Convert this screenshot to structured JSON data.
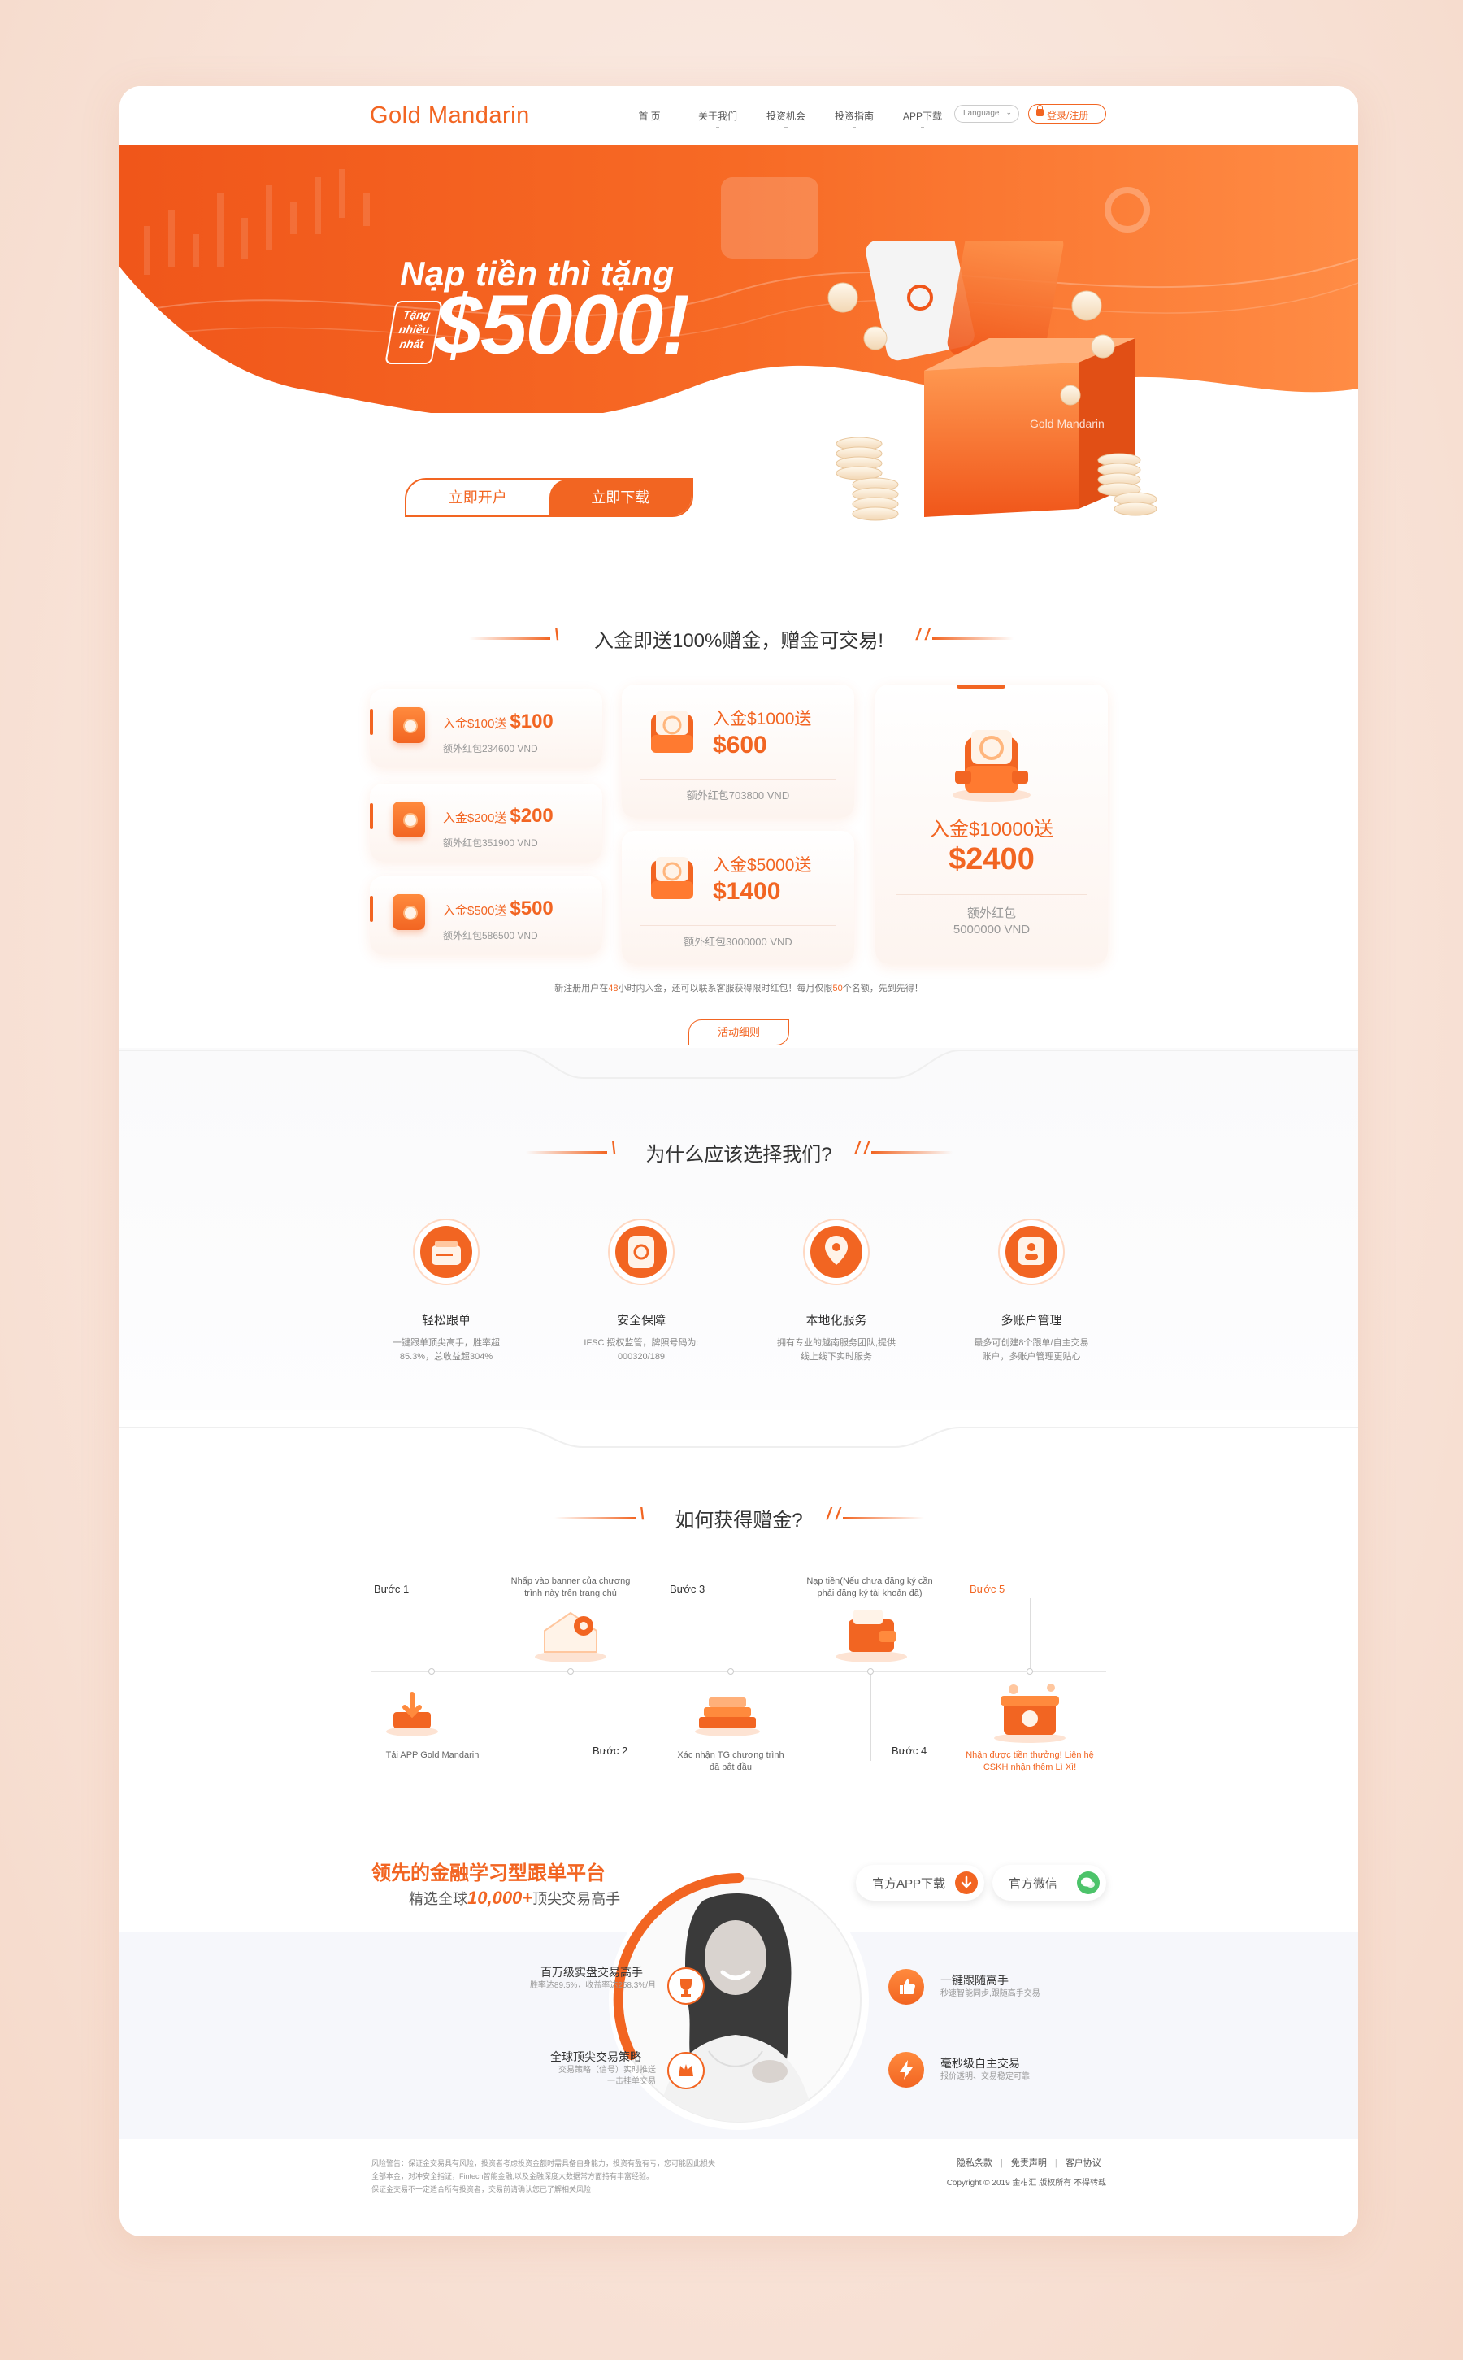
{
  "nav": {
    "logo": "Gold Mandarin",
    "menu": [
      "首 页",
      "关于我们",
      "投资机会",
      "投资指南",
      "APP下载"
    ],
    "language": "Language",
    "login": "登录/注册"
  },
  "hero": {
    "title": "Nạp tiền thì tặng",
    "tag": "Tặng nhiều nhất",
    "amount": "$5000!",
    "btn_open": "立即开户",
    "btn_download": "立即下载",
    "box_label": "Gold Mandarin"
  },
  "bonus": {
    "title": "入金即送100%赠金，赠金可交易!",
    "small": [
      {
        "prefix": "入金$100送",
        "amount": "$100",
        "sub": "额外红包234600 VND"
      },
      {
        "prefix": "入金$200送",
        "amount": "$200",
        "sub": "额外红包351900 VND"
      },
      {
        "prefix": "入金$500送",
        "amount": "$500",
        "sub": "额外红包586500 VND"
      }
    ],
    "medium": [
      {
        "prefix": "入金$1000送",
        "amount": "$600",
        "sub": "额外红包703800 VND"
      },
      {
        "prefix": "入金$5000送",
        "amount": "$1400",
        "sub": "额外红包3000000 VND"
      }
    ],
    "large": {
      "prefix": "入金$10000送",
      "amount": "$2400",
      "sub1": "额外红包",
      "sub2": "5000000 VND"
    },
    "note_a": "新注册用户在",
    "note_h1": "48",
    "note_b": "小时内入金，还可以联系客服获得限时红包！每月仅限",
    "note_h2": "50",
    "note_c": "个名额，先到先得！",
    "rules_btn": "活动细则"
  },
  "why": {
    "title": "为什么应该选择我们?",
    "features": [
      {
        "title": "轻松跟单",
        "desc1": "一键跟单顶尖高手，胜率超",
        "desc2": "85.3%，总收益超304%"
      },
      {
        "title": "安全保障",
        "desc1": "IFSC 授权监管，牌照号码为:",
        "desc2": "000320/189"
      },
      {
        "title": "本地化服务",
        "desc1": "拥有专业的越南服务团队,提供",
        "desc2": "线上线下实时服务"
      },
      {
        "title": "多账户管理",
        "desc1": "最多可创建8个跟单/自主交易",
        "desc2": "账户，多账户管理更贴心"
      }
    ]
  },
  "steps": {
    "title": "如何获得赠金?",
    "s1": "Bước 1",
    "s1_text": "Tải APP Gold Mandarin",
    "s2": "Bước 2",
    "s2_text_a": "Nhấp vào banner của chương",
    "s2_text_b": "trình này trên trang chủ",
    "s3": "Bước 3",
    "s3_text_a": "Xác nhận TG chương trình",
    "s3_text_b": "đã bắt đầu",
    "s4": "Bước 4",
    "s4_text_a": "Nạp tiền(Nếu chưa đăng ký cần",
    "s4_text_b": "phải đăng ký tài khoản đã)",
    "s5": "Bước 5",
    "s5_text_a": "Nhận được tiền thưởng! Liên hệ",
    "s5_text_b": "CSKH nhận thêm Lì Xì!"
  },
  "platform": {
    "title": "领先的金融学习型跟单平台",
    "sub_a": "精选全球",
    "sub_num": "10,000+",
    "sub_b": "顶尖交易高手",
    "app_btn": "官方APP下载",
    "wechat_btn": "官方微信",
    "f1_title": "百万级实盘交易高手",
    "f1_desc": "胜率达89.5%，收益率达258.3%/月",
    "f2_title": "全球顶尖交易策略",
    "f2_desc1": "交易策略（信号）实时推送",
    "f2_desc2": "一击挂单交易",
    "f3_title": "一键跟随高手",
    "f3_desc": "秒速智能同步,跟随高手交易",
    "f4_title": "毫秒级自主交易",
    "f4_desc": "报价透明、交易稳定可靠"
  },
  "footer": {
    "risk1": "风险警告：保证金交易具有风险，投资者考虑投资金额时需具备自身能力，投资有盈有亏，您可能因此损失",
    "risk2": "全部本金，对冲安全指证，Fintech智能金融,以及金融深度大数据常方面持有丰富经验。",
    "risk3": "保证金交易不一定适合所有投资者，交易前请确认您已了解相关风险",
    "links": [
      "隐私条款",
      "免责声明",
      "客户协议"
    ],
    "copyright": "Copyright © 2019 金柑汇 版权所有 不得转载"
  },
  "colors": {
    "brand": "#f26522",
    "brand_light": "#ff8a3d",
    "bg": "#f8e3d8"
  }
}
